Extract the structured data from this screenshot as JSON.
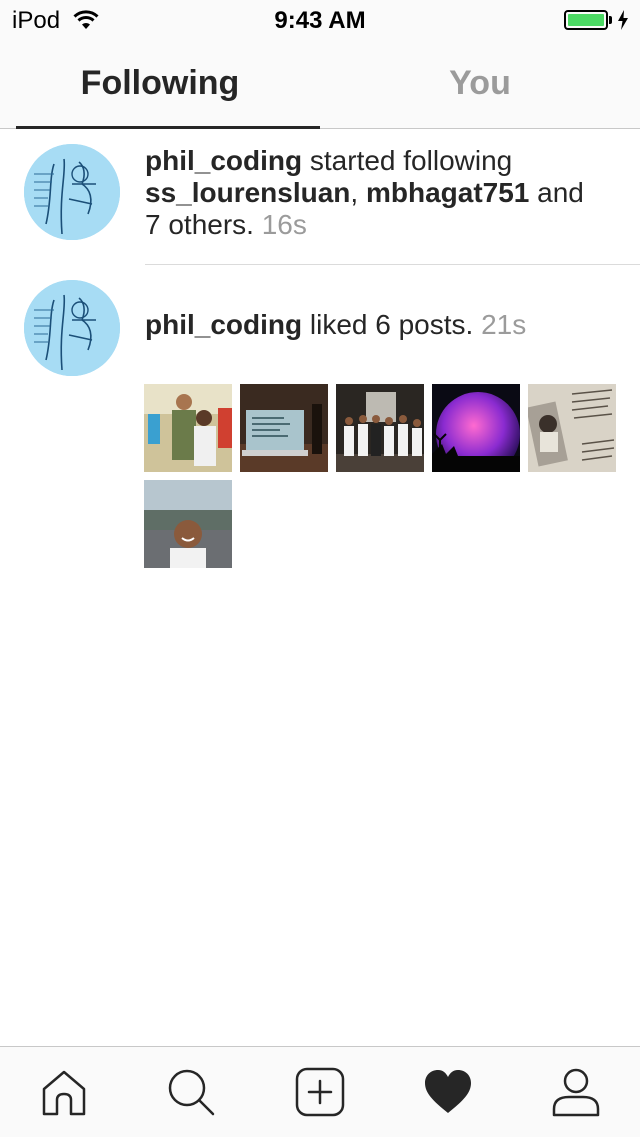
{
  "status_bar": {
    "carrier": "iPod",
    "time": "9:43 AM",
    "battery_level": 1.0,
    "battery_color": "#4cd964"
  },
  "tabs": {
    "following": "Following",
    "you": "You",
    "active": "following"
  },
  "feed": [
    {
      "user": "phil_coding",
      "action": "started following",
      "target1": "ss_lourensluan",
      "separator": ",",
      "target2": "mbhagat751",
      "conj": "and",
      "others": "7 others.",
      "time": "16s"
    },
    {
      "user": "phil_coding",
      "action": "liked 6 posts.",
      "time": "21s",
      "thumbnail_count": 6
    }
  ],
  "bottom_nav": [
    "home-icon",
    "search-icon",
    "add-post-icon",
    "activity-heart-icon",
    "profile-icon"
  ],
  "colors": {
    "text": "#262626",
    "muted": "#9b9b9b",
    "bar_bg": "#fafafa",
    "border": "#c8c8c8"
  }
}
